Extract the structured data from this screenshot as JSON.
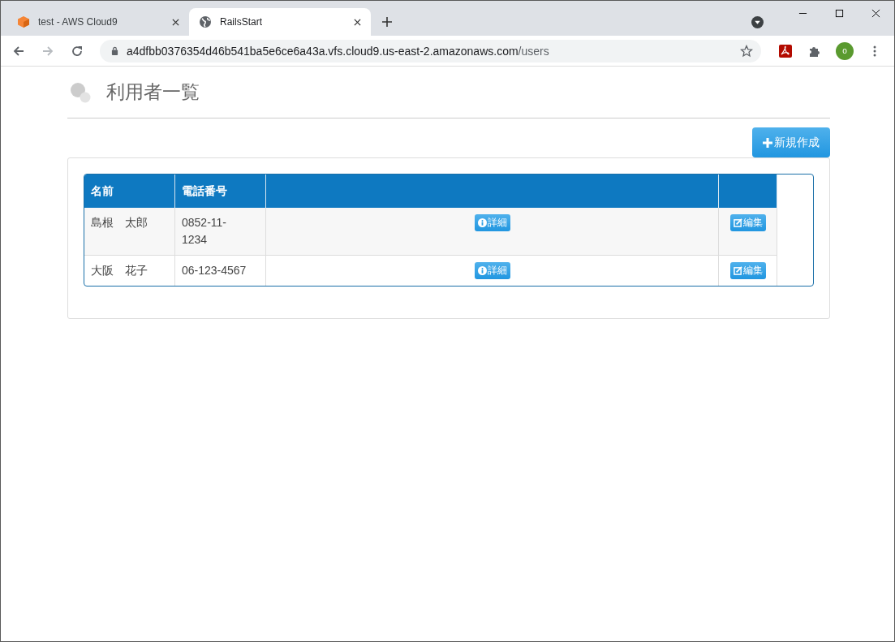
{
  "browser": {
    "tabs": [
      {
        "title": "test - AWS Cloud9",
        "kind": "cube",
        "selected": false
      },
      {
        "title": "RailsStart",
        "kind": "globe",
        "selected": true
      }
    ],
    "address": {
      "host": "a4dfbb0376354d46b541ba5e6ce6a43a.vfs.cloud9.us-east-2.amazonaws.com",
      "path": "/users"
    },
    "profile": "o"
  },
  "page": {
    "title": "利用者一覧",
    "new_button": "新規作成",
    "table": {
      "columns": [
        "名前",
        "電話番号"
      ],
      "rows": [
        {
          "name": "島根　太郎",
          "phone": "0852-11-1234",
          "detail": "詳細",
          "edit": "編集"
        },
        {
          "name": "大阪　花子",
          "phone": "06-123-4567",
          "detail": "詳細",
          "edit": "編集"
        }
      ]
    }
  }
}
